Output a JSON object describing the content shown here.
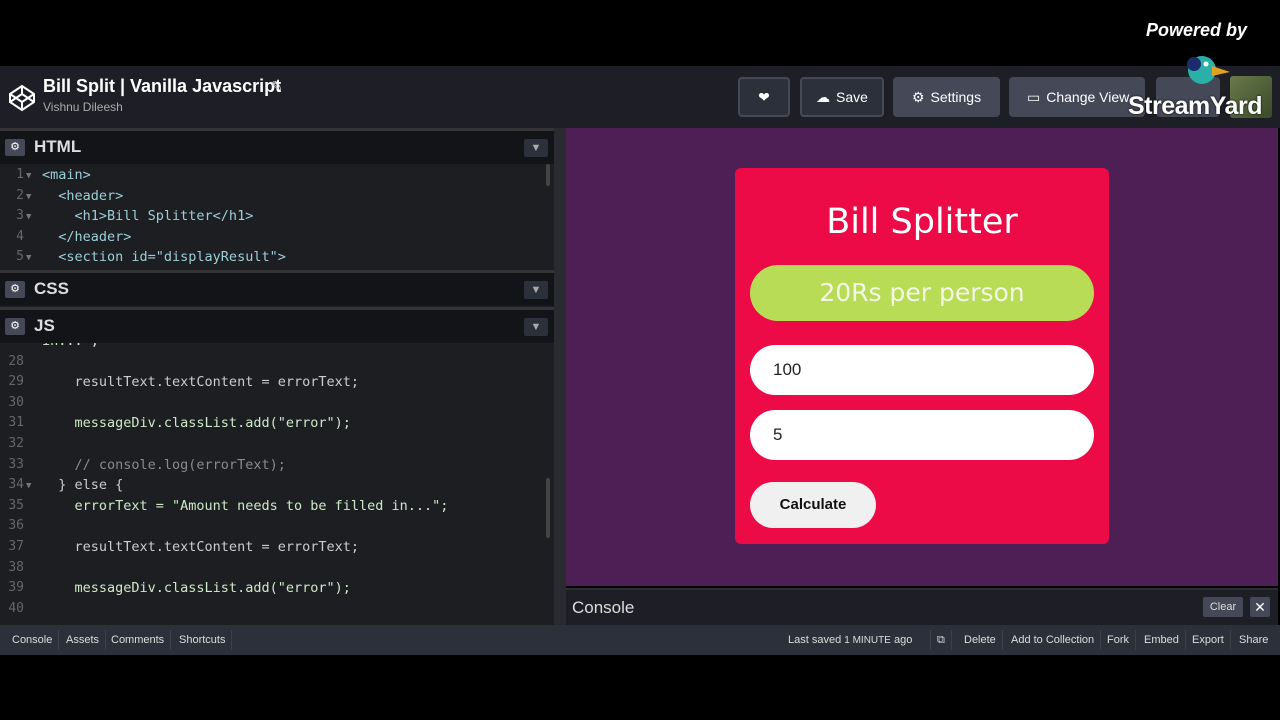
{
  "overlay": {
    "powered_by": "Powered by",
    "brand": "StreamYard"
  },
  "header": {
    "title": "Bill Split | Vanilla Javascript",
    "author": "Vishnu Dileesh",
    "buttons": {
      "save": "Save",
      "settings": "Settings",
      "change_view": "Change View"
    }
  },
  "editor": {
    "panels": {
      "html": "HTML",
      "css": "CSS",
      "js": "JS"
    },
    "html_lines": [
      {
        "n": "1",
        "text": "<main>"
      },
      {
        "n": "2",
        "text": "  <header>"
      },
      {
        "n": "3",
        "text": "    <h1>Bill Splitter</h1>"
      },
      {
        "n": "4",
        "text": "  </header>"
      },
      {
        "n": "5",
        "text": "  <section id=\"displayResult\">"
      }
    ],
    "js_lines": [
      {
        "n": "",
        "text": "in...\";"
      },
      {
        "n": "28",
        "text": ""
      },
      {
        "n": "29",
        "text": "    resultText.textContent = errorText;"
      },
      {
        "n": "30",
        "text": ""
      },
      {
        "n": "31",
        "text": "    messageDiv.classList.add(\"error\");"
      },
      {
        "n": "32",
        "text": ""
      },
      {
        "n": "33",
        "text": "    // console.log(errorText);"
      },
      {
        "n": "34",
        "text": "  } else {"
      },
      {
        "n": "35",
        "text": "    errorText = \"Amount needs to be filled in...\";"
      },
      {
        "n": "36",
        "text": ""
      },
      {
        "n": "37",
        "text": "    resultText.textContent = errorText;"
      },
      {
        "n": "38",
        "text": ""
      },
      {
        "n": "39",
        "text": "    messageDiv.classList.add(\"error\");"
      },
      {
        "n": "40",
        "text": ""
      }
    ]
  },
  "preview": {
    "title": "Bill Splitter",
    "result": "20Rs per person",
    "amount_value": "100",
    "people_value": "5",
    "calculate_label": "Calculate"
  },
  "console": {
    "label": "Console",
    "clear": "Clear"
  },
  "footer": {
    "left_buttons": [
      "Console",
      "Assets",
      "Comments",
      "Shortcuts"
    ],
    "saved_prefix": "Last saved",
    "saved_time": "1 MINUTE",
    "saved_suffix": "ago",
    "right_buttons": [
      "Delete",
      "Add to Collection",
      "Fork",
      "Embed",
      "Export",
      "Share"
    ]
  },
  "colors": {
    "preview_bg": "#4d1f55",
    "card": "#ec0b47",
    "result_pill": "#b8dc55",
    "editor_bg": "#1d1e22"
  }
}
